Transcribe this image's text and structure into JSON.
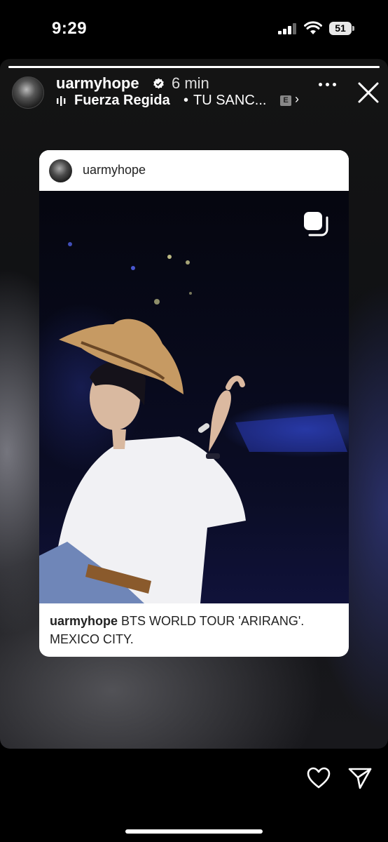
{
  "status_bar": {
    "time": "9:29",
    "battery": "51"
  },
  "story": {
    "progress": 1.0,
    "username": "uarmyhope",
    "time_ago": "6 min",
    "music": {
      "artist": "Fuerza Regida",
      "separator": "•",
      "song": "TU SANC...",
      "explicit": "E",
      "chevron": "›"
    }
  },
  "post": {
    "username": "uarmyhope",
    "caption_user": "uarmyhope",
    "caption_text": "BTS WORLD TOUR 'ARIRANG'. MEXICO CITY."
  },
  "icons": {
    "verified": "verified-badge-icon",
    "music": "music-bars-icon",
    "more": "more-icon",
    "close": "close-icon",
    "multi": "multi-photo-icon",
    "like": "heart-icon",
    "share": "send-icon"
  }
}
